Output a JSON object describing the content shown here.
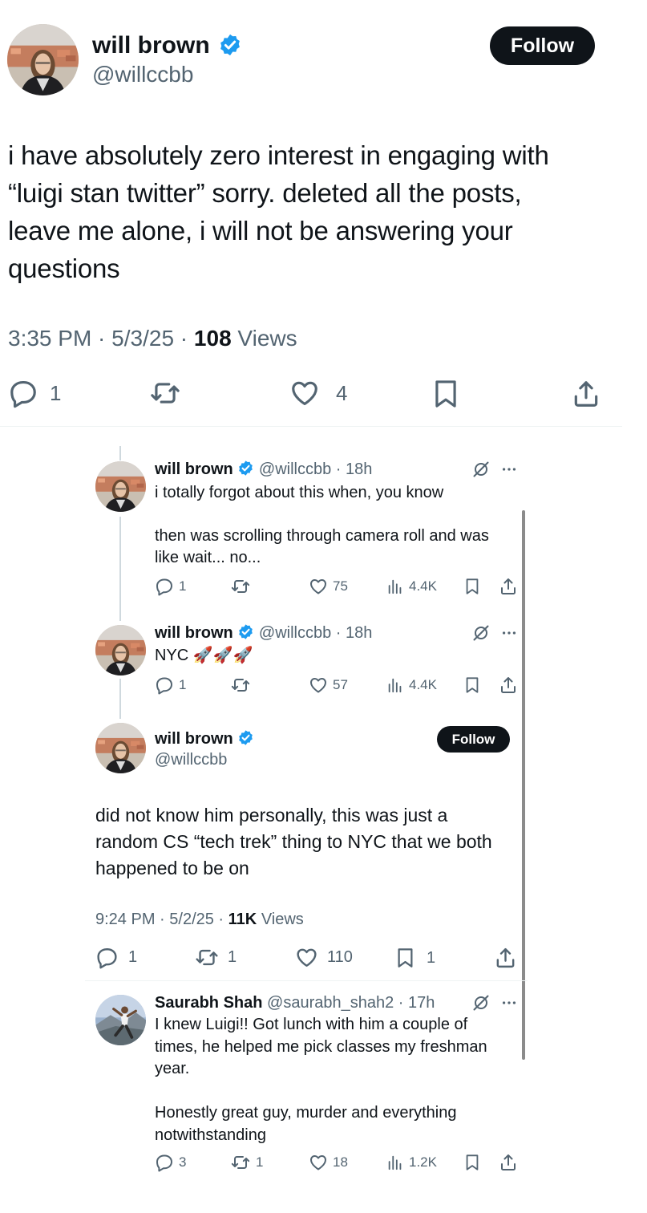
{
  "main_post": {
    "author": {
      "name": "will brown",
      "handle": "@willccbb"
    },
    "follow_label": "Follow",
    "text_lines": [
      "i have absolutely zero interest in engaging with",
      "“luigi stan twitter” sorry. deleted all the posts,",
      "leave me alone, i will not be answering your",
      "questions"
    ],
    "time": "3:35 PM",
    "date": "5/3/25",
    "views_count": "108",
    "views_label": "Views",
    "replies": "1",
    "likes": "4"
  },
  "reply_1": {
    "name": "will brown",
    "handle": "@willccbb",
    "age": "18h",
    "text_lines": [
      "i totally forgot about this when, you know",
      "",
      "then was scrolling through camera roll and was",
      "like wait... no..."
    ],
    "replies": "1",
    "likes": "75",
    "views": "4.4K"
  },
  "reply_2": {
    "name": "will brown",
    "handle": "@willccbb",
    "age": "18h",
    "text": "NYC",
    "emoji": "🚀🚀🚀",
    "replies": "1",
    "likes": "57",
    "views": "4.4K"
  },
  "focus_post": {
    "name": "will brown",
    "handle": "@willccbb",
    "follow_label": "Follow",
    "text_lines": [
      "did not know him personally, this was just a",
      "random CS “tech trek” thing to NYC that we both",
      "happened to be on"
    ],
    "time": "9:24 PM",
    "date": "5/2/25",
    "views_count": "11K",
    "views_label": "Views",
    "replies": "1",
    "reposts": "1",
    "likes": "110",
    "bookmarks": "1"
  },
  "reply_3": {
    "name": "Saurabh Shah",
    "handle": "@saurabh_shah2",
    "age": "17h",
    "text_lines": [
      "I knew Luigi!! Got lunch with him a couple of",
      "times, he helped me pick classes my freshman",
      "year.",
      "",
      "Honestly great guy, murder and everything",
      "notwithstanding"
    ],
    "replies": "3",
    "reposts": "1",
    "likes": "18",
    "views": "1.2K"
  },
  "icons": {
    "verified": "verified-badge-icon",
    "reply": "speech-bubble-icon",
    "repost": "repost-arrows-icon",
    "like": "heart-icon",
    "bookmark": "bookmark-icon",
    "share": "share-upload-icon",
    "views": "bar-chart-icon",
    "grok": "grok-slash-circle-icon",
    "more": "more-dots-icon"
  },
  "colors": {
    "verified": "#1d9bf0",
    "text": "#0f1419",
    "muted": "#536471",
    "button": "#0f1419"
  }
}
